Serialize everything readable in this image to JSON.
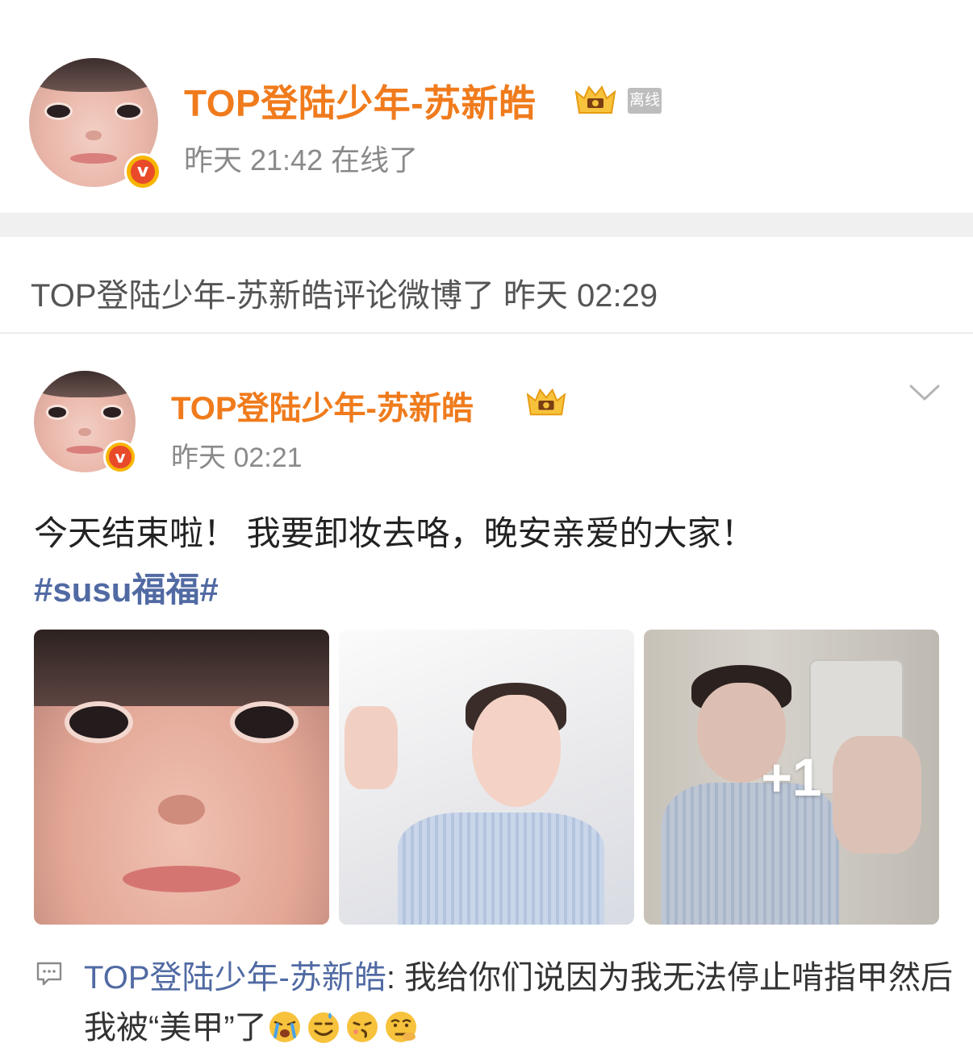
{
  "profile": {
    "name": "TOP登陆少年-苏新皓",
    "offline_tag": "离线",
    "online_status": "昨天 21:42 在线了",
    "verified_icon": "verified-v-icon",
    "crown_icon": "crown-badge-icon"
  },
  "activity": {
    "text": "TOP登陆少年-苏新皓评论微博了 昨天 02:29"
  },
  "post": {
    "author": "TOP登陆少年-苏新皓",
    "time": "昨天 02:21",
    "text": "今天结束啦！ 我要卸妆去咯，晚安亲爱的大家！",
    "hashtag": "#susu福福#",
    "more_count": "+1",
    "menu_icon": "chevron-down-icon"
  },
  "comment": {
    "author": "TOP登陆少年-苏新皓",
    "separator": ": ",
    "text": "我给你们说因为我无法停止啃指甲然后我被“美甲”了",
    "emojis": [
      "crying-emoji",
      "sweat-emoji",
      "grin-emoji",
      "thinking-emoji"
    ]
  },
  "colors": {
    "accent_orange": "#f07b1c",
    "link_blue": "#516aa3",
    "muted_gray": "#8a8a8a"
  }
}
